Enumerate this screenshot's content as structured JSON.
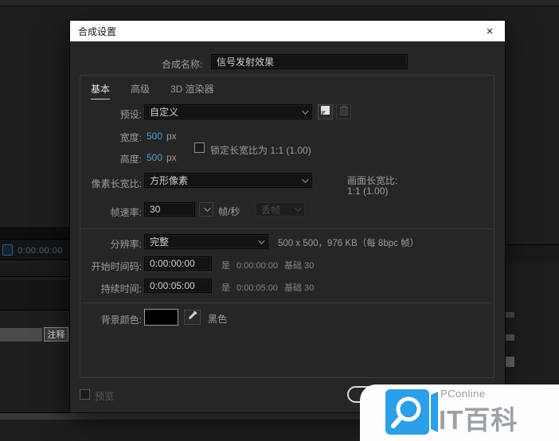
{
  "window": {
    "title": "合成设置",
    "close_glyph": "×"
  },
  "dialog": {
    "name_label": "合成名称:",
    "name_value": "信号发射效果",
    "tabs": [
      {
        "label": "基本"
      },
      {
        "label": "高级"
      },
      {
        "label": "3D 渲染器"
      }
    ],
    "preset": {
      "label": "预设:",
      "value": "自定义"
    },
    "width": {
      "label": "宽度:",
      "value": "500",
      "unit": "px"
    },
    "height": {
      "label": "高度:",
      "value": "500",
      "unit": "px"
    },
    "lock_aspect_label": "锁定长宽比为 1:1 (1.00)",
    "pixel_aspect": {
      "label": "像素长宽比:",
      "value": "方形像素"
    },
    "frame_aspect": {
      "label": "画面长宽比:",
      "value": "1:1 (1.00)"
    },
    "frame_rate": {
      "label": "帧速率:",
      "value": "30",
      "unit": "帧/秒",
      "drop_frame_value": "丢帧"
    },
    "resolution": {
      "label": "分辨率:",
      "value": "完整",
      "info": "500 x 500，976 KB（每 8bpc 帧）"
    },
    "start_timecode": {
      "label": "开始时间码:",
      "value": "0:00:00:00",
      "is_label": "是",
      "is_value": "0:00:00:00",
      "base_value": "基础 30"
    },
    "duration": {
      "label": "持续时间:",
      "value": "0:00:05:00",
      "is_label": "是",
      "is_value": "0:00:05:00",
      "base_value": "基础 30"
    },
    "background_color": {
      "label": "背景颜色:",
      "name": "黑色",
      "hex": "#000000"
    },
    "preview_label": "预览"
  },
  "background": {
    "timecode": "0:00:00:00",
    "note_label": "注释"
  },
  "watermark": {
    "brand": "PConline",
    "title": "IT百科"
  },
  "colors": {
    "value_blue": "#4b9edb",
    "watermark_blue": "#2b9fe8",
    "swatch_black": "#000000"
  }
}
